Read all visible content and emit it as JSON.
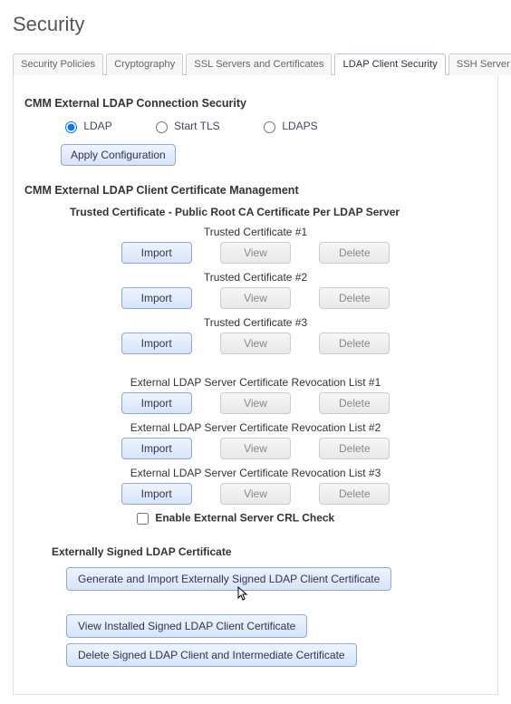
{
  "page_title": "Security",
  "tabs": [
    {
      "label": "Security Policies",
      "active": false
    },
    {
      "label": "Cryptography",
      "active": false
    },
    {
      "label": "SSL Servers and Certificates",
      "active": false
    },
    {
      "label": "LDAP Client Security",
      "active": true
    },
    {
      "label": "SSH Server",
      "active": false
    }
  ],
  "conn_security": {
    "title": "CMM External LDAP Connection Security",
    "options": [
      {
        "label": "LDAP",
        "checked": true
      },
      {
        "label": "Start TLS",
        "checked": false
      },
      {
        "label": "LDAPS",
        "checked": false
      }
    ],
    "apply_label": "Apply Configuration"
  },
  "cert_mgmt": {
    "title": "CMM External LDAP Client Certificate Management",
    "trusted_title": "Trusted Certificate - Public Root CA Certificate Per LDAP Server",
    "trusted": [
      {
        "label": "Trusted Certificate #1"
      },
      {
        "label": "Trusted Certificate #2"
      },
      {
        "label": "Trusted Certificate #3"
      }
    ],
    "crl": [
      {
        "label": "External LDAP Server Certificate Revocation List #1"
      },
      {
        "label": "External LDAP Server Certificate Revocation List #2"
      },
      {
        "label": "External LDAP Server Certificate Revocation List #3"
      }
    ],
    "buttons": {
      "import": "Import",
      "view": "View",
      "delete": "Delete"
    },
    "enable_crl_label": "Enable External Server CRL Check",
    "enable_crl_checked": false
  },
  "ext_signed": {
    "title": "Externally Signed LDAP Certificate",
    "generate_label": "Generate and Import Externally Signed LDAP Client Certificate",
    "view_label": "View Installed Signed LDAP Client Certificate",
    "delete_label": "Delete Signed LDAP Client and Intermediate Certificate"
  }
}
